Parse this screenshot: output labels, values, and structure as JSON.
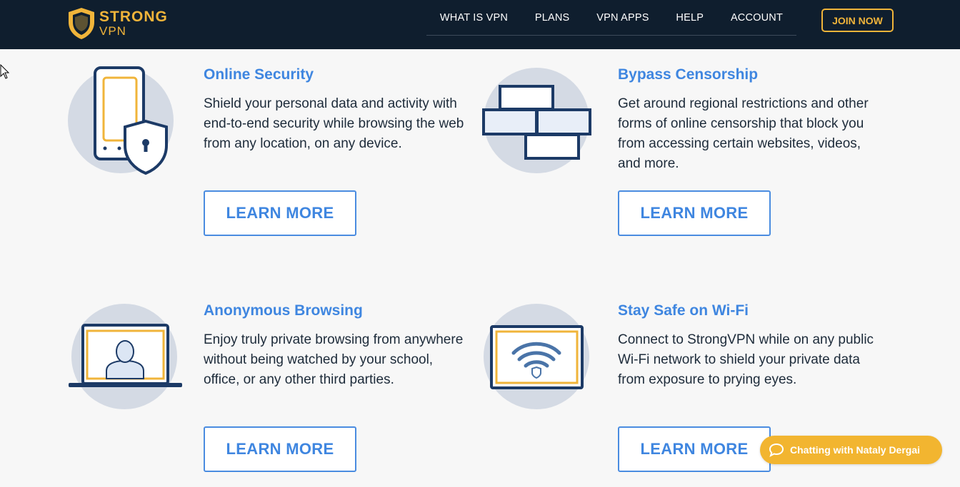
{
  "brand": {
    "name": "STRONG",
    "sub": "VPN"
  },
  "nav": {
    "items": [
      "WHAT IS VPN",
      "PLANS",
      "VPN APPS",
      "HELP",
      "ACCOUNT"
    ],
    "join_label": "JOIN NOW"
  },
  "features": [
    {
      "title": "Online Security",
      "text": "Shield your personal data and activity with end-to-end security while browsing the web from any location, on any device.",
      "button": "LEARN MORE",
      "icon": "phone-shield-icon"
    },
    {
      "title": "Bypass Censorship",
      "text": "Get around regional restrictions and other forms of online censorship that block you from accessing certain websites, videos, and more.",
      "button": "LEARN MORE",
      "icon": "brick-wall-icon"
    },
    {
      "title": "Anonymous Browsing",
      "text": "Enjoy truly private browsing from anywhere without being watched by your school, office, or any other third parties.",
      "button": "LEARN MORE",
      "icon": "laptop-user-icon"
    },
    {
      "title": "Stay Safe on Wi-Fi",
      "text": "Connect to StrongVPN while on any public Wi-Fi network to shield your private data from exposure to prying eyes.",
      "button": "LEARN MORE",
      "icon": "wifi-screen-icon"
    }
  ],
  "chat": {
    "label": "Chatting with Nataly Dergai"
  },
  "colors": {
    "header_bg": "#0f1e2e",
    "accent_gold": "#f0b43a",
    "link_blue": "#3f86e0",
    "icon_navy": "#1c3a66",
    "circle_gray": "#d4dae4"
  }
}
